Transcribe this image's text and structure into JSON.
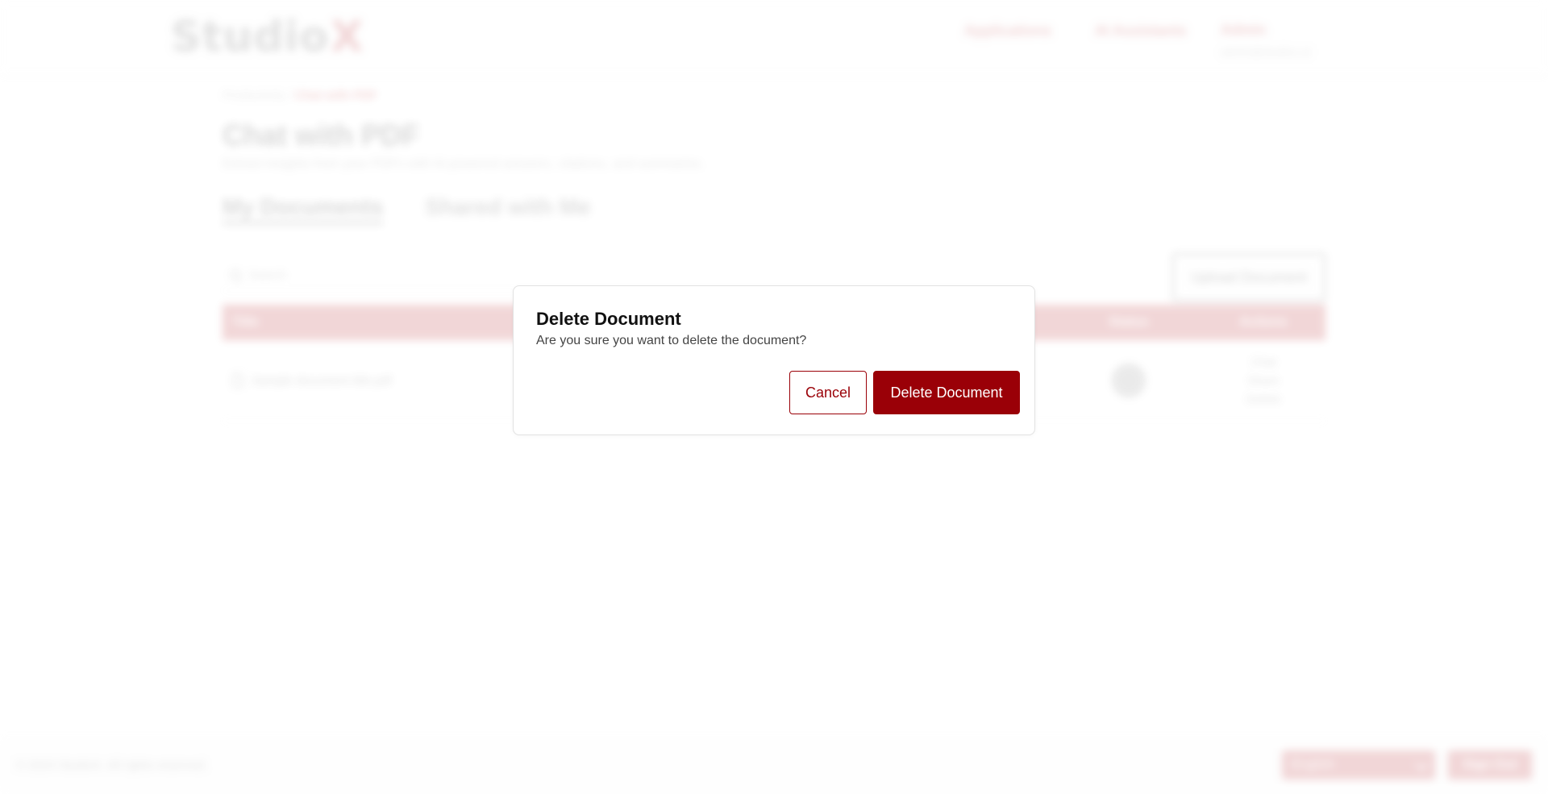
{
  "background": {
    "logo": {
      "main": "Studio",
      "accent": "X"
    },
    "nav": {
      "applications": "Applications",
      "ai_assistants": "AI Assistants",
      "user_name": "Admin",
      "user_email": "admin@studiox.ai"
    },
    "breadcrumb": {
      "root": "Productivity",
      "separator": " / ",
      "current": "Chat with PDF"
    },
    "title": "Chat with PDF",
    "subtitle": "Extract insights from your PDFs with AI-powered answers, citations, and summaries.",
    "tabs": [
      {
        "label": "My Documents"
      },
      {
        "label": "Shared with Me"
      }
    ],
    "search_placeholder": "Search",
    "upload_button": "Upload Document",
    "table": {
      "headers": {
        "title": "Title",
        "status": "Status",
        "actions": "Actions"
      },
      "rows": [
        {
          "title": "Sample document title.pdf",
          "actions": [
            "Chat",
            "Share",
            "Delete"
          ]
        }
      ]
    },
    "footer": {
      "copyright": "© 2024 StudioX. All rights reserved.",
      "language": "English",
      "sign_out": "Sign Out"
    }
  },
  "modal": {
    "title": "Delete Document",
    "message": "Are you sure you want to delete the document?",
    "cancel_label": "Cancel",
    "confirm_label": "Delete Document"
  },
  "colors": {
    "accent": "#9a0007",
    "brand_red": "#b7181e",
    "text_dark": "#111111"
  },
  "icons": {
    "search": "search-icon",
    "document": "document-icon",
    "chevron": "chevron-down-icon"
  }
}
